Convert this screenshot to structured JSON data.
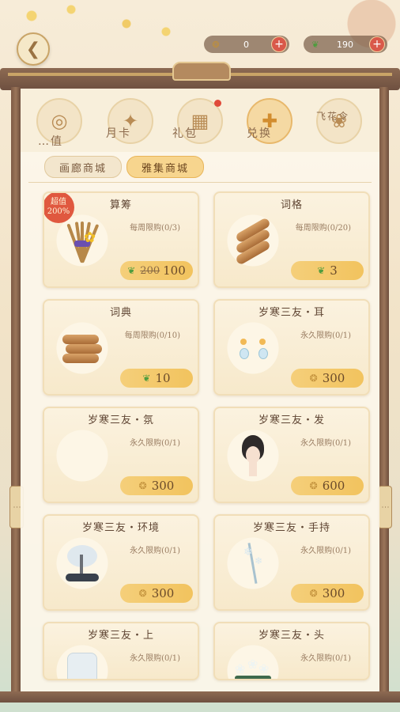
{
  "header": {
    "back_icon": "chevron-left-icon",
    "currencies": [
      {
        "icon": "gold-coin-icon",
        "value": "0"
      },
      {
        "icon": "jade-leaf-icon",
        "value": "190"
      }
    ],
    "plus": "+"
  },
  "frame": {
    "side_marks": "⋮"
  },
  "tabs": [
    {
      "label": "…值",
      "icon": "coin-scroll-icon",
      "glyph": "◎",
      "active": false
    },
    {
      "label": "月卡",
      "icon": "month-card-icon",
      "glyph": "✦",
      "active": false
    },
    {
      "label": "礼包",
      "icon": "gift-pack-icon",
      "glyph": "▦",
      "active": false,
      "dot": true
    },
    {
      "label": "兑换",
      "icon": "exchange-gift-icon",
      "glyph": "✚",
      "active": true
    },
    {
      "label": "飞花令",
      "icon": "flower-card-icon",
      "glyph": "❀",
      "active": false
    }
  ],
  "subtabs": [
    {
      "label": "画廊商城",
      "active": false
    },
    {
      "label": "雅集商城",
      "active": true
    }
  ],
  "cards": [
    {
      "title": "算筹",
      "limit": "每周限购(0/3)",
      "price_icon": "jade-leaf-icon",
      "old_price": "200",
      "price": "100",
      "badge_line1": "超值",
      "badge_line2": "200%",
      "art": "counting-sticks"
    },
    {
      "title": "词格",
      "limit": "每周限购(0/20)",
      "price_icon": "jade-leaf-icon",
      "price": "3",
      "art": "scroll-bundle-small"
    },
    {
      "title": "词典",
      "limit": "每周限购(0/10)",
      "price_icon": "jade-leaf-icon",
      "price": "10",
      "art": "scroll-bundle-large"
    },
    {
      "title": "岁寒三友・耳",
      "limit": "永久限购(0/1)",
      "price_icon": "gold-coin-icon",
      "price": "300",
      "art": "earrings"
    },
    {
      "title": "岁寒三友・氛",
      "limit": "永久限购(0/1)",
      "price_icon": "gold-coin-icon",
      "price": "300",
      "art": "aura"
    },
    {
      "title": "岁寒三友・发",
      "limit": "永久限购(0/1)",
      "price_icon": "gold-coin-icon",
      "price": "600",
      "art": "hairstyle"
    },
    {
      "title": "岁寒三友・环境",
      "limit": "永久限购(0/1)",
      "price_icon": "gold-coin-icon",
      "price": "300",
      "art": "bonsai"
    },
    {
      "title": "岁寒三友・手持",
      "limit": "永久限购(0/1)",
      "price_icon": "gold-coin-icon",
      "price": "300",
      "art": "handheld-branch"
    },
    {
      "title": "岁寒三友・上",
      "limit": "永久限购(0/1)",
      "art": "upper-garment"
    },
    {
      "title": "岁寒三友・头",
      "limit": "永久限购(0/1)",
      "art": "headpiece"
    }
  ]
}
